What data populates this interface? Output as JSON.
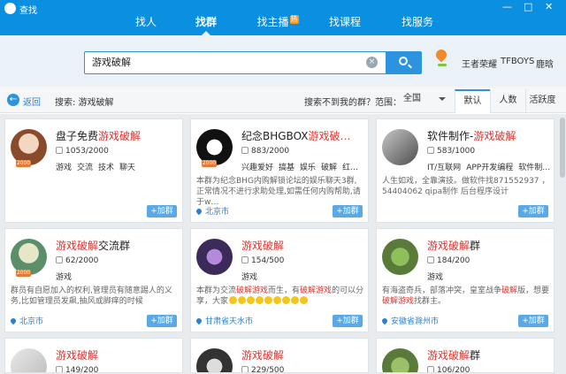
{
  "window": {
    "title": "查找",
    "min": "—",
    "restore": "□",
    "close": "✕"
  },
  "nav": {
    "items": [
      {
        "label": "找人"
      },
      {
        "label": "找群"
      },
      {
        "label": "找主播"
      },
      {
        "label": "找课程"
      },
      {
        "label": "找服务"
      }
    ],
    "hot_badge": "热"
  },
  "search": {
    "value": "游戏破解",
    "hot_keywords": [
      "王者荣耀",
      "TFBOYS",
      "鹿晗"
    ],
    "clear": "×"
  },
  "filter": {
    "back_label": "返回",
    "search_label": "搜索: 游戏破解",
    "not_found": "搜索不到我的群？",
    "range_label": "范围：",
    "range_value": "全国",
    "sort_tabs": [
      "默认",
      "人数",
      "活跃度"
    ]
  },
  "cards": [
    {
      "name_hl": "游戏破解",
      "name_prefix": "盘子免费",
      "name_suffix": "",
      "level": "2000",
      "count": "1053/2000",
      "tags": [
        "游戏",
        "交流",
        "技术",
        "聊天"
      ],
      "desc_parts": [],
      "location": "",
      "join": "+加群"
    },
    {
      "name_hl": "游戏破…",
      "name_prefix": "纪念BHGBOX",
      "name_suffix": "",
      "level": "2000",
      "count": "883/2000",
      "tags": [
        "兴趣爱好",
        "搞基",
        "娱乐",
        "破解",
        "红…"
      ],
      "desc_parts": [
        {
          "t": "本群为纪念BHG内购解锁论坛的娱乐聊天3群,正常情况不进行求助处理,如需任何内购帮助,请于w…"
        }
      ],
      "location": "北京市",
      "join": "+加群"
    },
    {
      "name_hl": "游戏破解",
      "name_prefix": "软件制作-",
      "name_suffix": "",
      "level": "",
      "count": "583/1000",
      "tags": [
        "IT/互联网",
        "APP开发编程",
        "软件制…"
      ],
      "desc_parts": [
        {
          "t": "人生如戏，全靠演技。做软件找871552937  ，54404062 qipa制作 后台程序设计"
        }
      ],
      "location": "",
      "join": "+加群"
    },
    {
      "name_hl": "游戏破解",
      "name_prefix": "",
      "name_suffix": "交流群",
      "level": "2000",
      "count": "62/2000",
      "tags": [
        "游戏"
      ],
      "desc_parts": [
        {
          "t": "群员有自愿加入的权利,管理员有随意踢人的义务,比如管理员发飙,抽风或脚痒的时候"
        }
      ],
      "location": "北京市",
      "join": "+加群"
    },
    {
      "name_hl": "游戏破解",
      "name_prefix": "",
      "name_suffix": "",
      "level": "",
      "count": "154/500",
      "tags": [
        "游戏"
      ],
      "desc_parts": [
        {
          "t": "本群为交流"
        },
        {
          "t": "破解游戏",
          "hl": true
        },
        {
          "t": "而生，有"
        },
        {
          "t": "破解游戏",
          "hl": true
        },
        {
          "t": "的可以分享，大家"
        }
      ],
      "location": "甘肃省天水市",
      "join": "+加群",
      "emoji": true
    },
    {
      "name_hl": "游戏破解",
      "name_prefix": "",
      "name_suffix": "群",
      "level": "",
      "count": "184/200",
      "tags": [
        "游戏"
      ],
      "desc_parts": [
        {
          "t": "有海盗奇兵，部落冲突，皇室战争"
        },
        {
          "t": "破解",
          "hl": true
        },
        {
          "t": "版，想要"
        },
        {
          "t": "破解游戏",
          "hl": true
        },
        {
          "t": "找群主。"
        }
      ],
      "location": "安徽省滁州市",
      "join": "+加群"
    },
    {
      "name_hl": "游戏破解",
      "name_prefix": "",
      "name_suffix": "",
      "level": "",
      "count": "149/200",
      "tags": [],
      "desc_parts": [],
      "location": "",
      "join": ""
    },
    {
      "name_hl": "游戏破解",
      "name_prefix": "",
      "name_suffix": "",
      "level": "",
      "count": "229/500",
      "tags": [],
      "desc_parts": [],
      "location": "",
      "join": ""
    },
    {
      "name_hl": "游戏破解",
      "name_prefix": "",
      "name_suffix": "群",
      "level": "",
      "count": "106/200",
      "tags": [],
      "desc_parts": [],
      "location": "",
      "join": ""
    }
  ],
  "colors": {
    "brand": "#0b8fe0",
    "accent": "#2c93df",
    "highlight": "#e0332e"
  }
}
